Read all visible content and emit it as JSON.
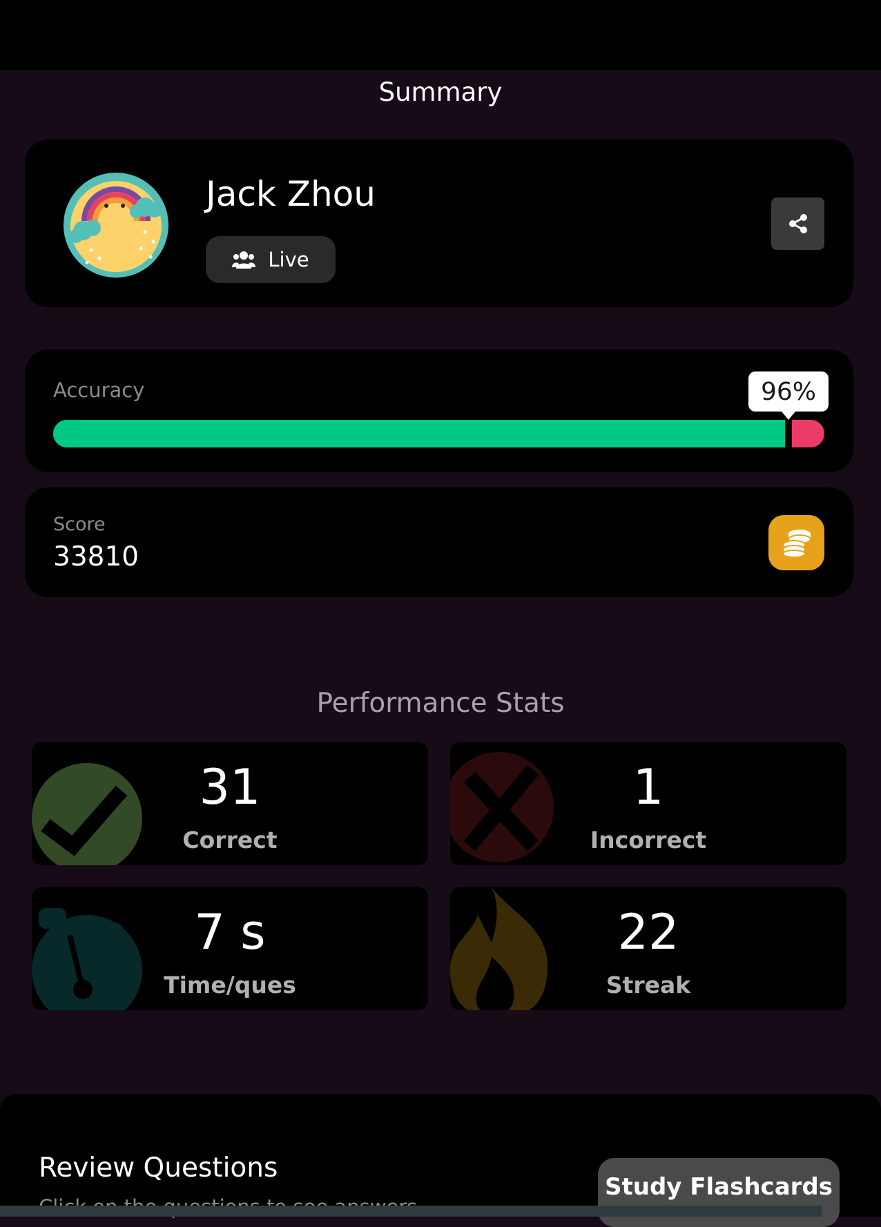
{
  "header": {
    "title": "Summary"
  },
  "profile": {
    "name": "Jack Zhou",
    "mode_label": "Live",
    "share_icon": "share-icon",
    "avatar_icon": "rainbow-sun-avatar"
  },
  "accuracy": {
    "label": "Accuracy",
    "value_text": "96%",
    "value": 0.96,
    "colors": {
      "correct": "#00c985",
      "incorrect": "#ec3b67"
    }
  },
  "score": {
    "label": "Score",
    "value": "33810",
    "icon": "coins-icon"
  },
  "performance": {
    "title": "Performance Stats",
    "stats": [
      {
        "value": "31",
        "label": "Correct",
        "icon": "check-icon",
        "icon_color": "#334a26"
      },
      {
        "value": "1",
        "label": "Incorrect",
        "icon": "cross-icon",
        "icon_color": "#2a0a0a"
      },
      {
        "value": "7 s",
        "label": "Time/ques",
        "icon": "stopwatch-icon",
        "icon_color": "#07292a"
      },
      {
        "value": "22",
        "label": "Streak",
        "icon": "flame-icon",
        "icon_color": "#3a2a06"
      }
    ]
  },
  "review": {
    "title": "Review Questions",
    "subtitle": "Click on the questions to see answers",
    "flashcards_button": "Study Flashcards"
  }
}
